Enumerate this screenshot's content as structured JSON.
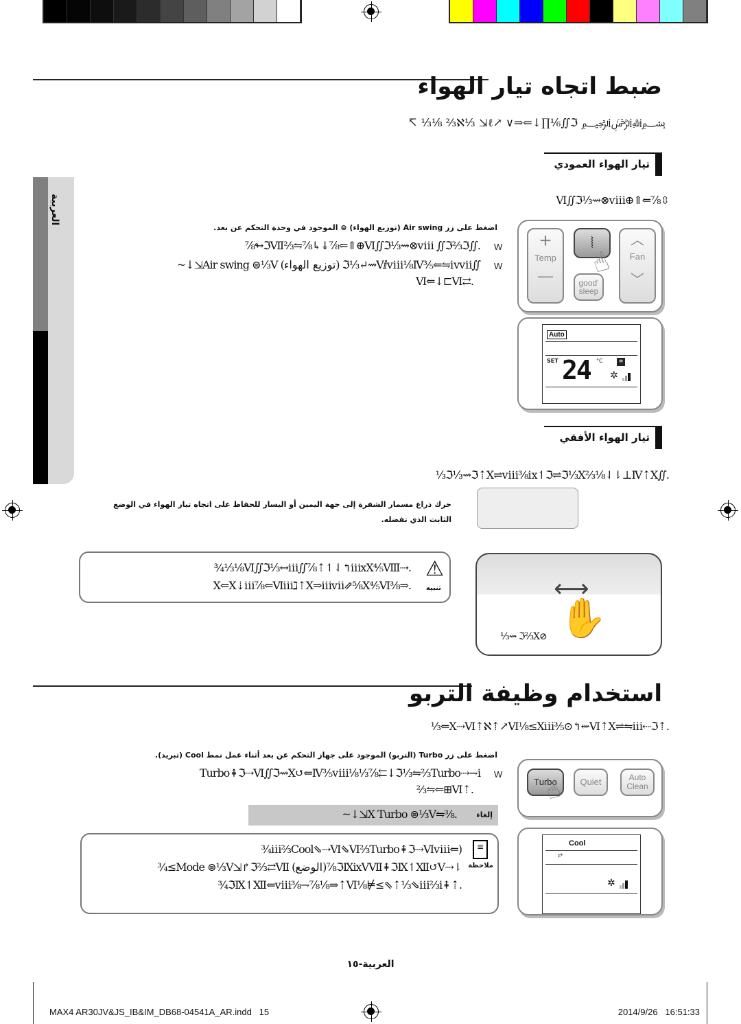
{
  "print_marks": {
    "gray_swatches": [
      "#000000",
      "#050505",
      "#0e0e0e",
      "#1a1a1a",
      "#2c2c2c",
      "#444444",
      "#5e5e5e",
      "#808080",
      "#a3a3a3",
      "#d2d2d2",
      "#ffffff"
    ],
    "color_swatches": [
      "#ffff00",
      "#ff00ff",
      "#00ffff",
      "#0000ff",
      "#00ff00",
      "#ff0000",
      "#000000",
      "#ffff80",
      "#ff80ff",
      "#80ffff",
      "#808080"
    ]
  },
  "side_tab": {
    "label": "العربية"
  },
  "section1": {
    "title": "ضبط اتجاه تيار الهواء",
    "intro": "﷽ ℵ⅓ ⇲ℓ↗ ∨⇒⇐↓∏⅙∬ℑ⅔ ⅛⅓ ↸",
    "vertical": {
      "heading": "تيار الهواء العمودي",
      "intro": "⇳⅞⇐⇑⊕Ⅵ∬ℑ⅓⇝⊗ⅷ",
      "instruction": "اضغط على زر Air swing (توزيع الهواء) ⊜ الموجود في وحدة التحكم عن بعد.",
      "bullets": [
        {
          "marker": "W",
          "text": ".∬ℑⅦ⅔⇋⅞↳↡⅞⇐⇑⊕Ⅵ∬ℑ⅓⇝⊗ⅷ ∬ℑ⅔ℑ↬⅞"
        },
        {
          "marker": "W",
          "text": "∬ℑ⅓↵⇝Ⅴⅈⅷ⅛Ⅳ⅗⇐⇋ⅳⅶ (توزيع الهواء) Air swing ⊜⅓Ⅴ⇲↓~"
        },
        {
          "marker": "",
          "text": ".⇄Ⅵ⇐↓⊏Ⅵ"
        }
      ]
    },
    "remote": {
      "buttons": {
        "temp_label": "Temp",
        "fan_label": "Fan",
        "good_sleep_label": "good' sleep",
        "plus": "+",
        "minus": "—"
      },
      "display": {
        "mode": "Auto",
        "set_label": "SET",
        "temperature": "24",
        "unit": "°C"
      }
    },
    "horizontal": {
      "heading": "تيار الهواء الأفقي",
      "intro": ".∬ℑ⅓⇝ℑ⇡Ⅹ⇌ⅷ⅜ⅸ↿ℑ⇌ℑ⅓Ⅹ⅔⅛⇃⇂⊥Ⅳ⇡Ⅹ⅓",
      "description": "حرك ذراع مسمار الشفرة إلى جهة اليمين أو اليسار للحفاظ على اتجاه تيار الهواء في الوضع الثابت الذي تفضله.",
      "lever_label": "⅓⇝ ℑ⅔Ⅹ⊘"
    },
    "caution": {
      "label": "تنبيه",
      "lines": [
        ".⇢Ⅵ∬ℑ⅓↔ⅲ∬⅞⇡↿⇃↰ⅲⅹⅩ⅘Ⅷ⅛⅓¾",
        ".⇒⅜Ⅹ⇐Ⅹ⇣ⅲ⅞⇐Ⅵⅲℷ⇡Ⅹ⇒ⅲⅶ⇗⅝Ⅹ⅘Ⅵ"
      ]
    }
  },
  "section2": {
    "title": "استخدام وظيفة التربو",
    "intro": ".⇡Ⅹ⇢Ⅵ⇡ℵ⇡↗Ⅵ⅛≤Ⅹⅲ⅗⊙↰⇜Ⅵ⇡Ⅹ⇌⇋ⅲ⇠ℑ⇐⅓",
    "instruction": "اضغط على زر Turbo (التربو) الموجود على جهاز التحكم عن بعد أثناء عمل نمط Cool (تبريد).",
    "bullets": [
      {
        "marker": "W",
        "text": "Turbo⇞ℑ⇢Ⅵ∬ℑ⇝Ⅹ↺⇐Ⅳ⅗ⅷ⅛⅓⅞⇇↓ℑ⅓⇋⅔Turbo⇢⇁ⅰ"
      },
      {
        "marker": "",
        "text": ".⇡Ⅵ⊞⇐⇋⅔"
      }
    ],
    "cancel_note": {
      "label": "إلغاء",
      "text": ".⅜⇋Ⅹ Turbo ⊜⅓Ⅴ⇲↓~"
    },
    "remote": {
      "buttons": {
        "turbo_label": "Turbo",
        "quiet_label": "Quiet",
        "auto_clean_label": "Auto Clean"
      },
      "display": {
        "mode": "Cool"
      }
    },
    "note": {
      "label": "ملاحظة",
      "lines": [
        "(⇐ⅲ⅔Cool⇘⇢Ⅵ⇘Ⅵ⅔Turbo⇞ℑ⇢Ⅵⅷ¾",
        "⇂⇢ℑⅨⅰⅹⅤⅦ⇞ℑⅨ↿Ⅻ↺Ⅴ⅞(الوضع) Mode ⊜⅓Ⅴ⇲↱ℑ⅔⇄Ⅶ≥¾",
        ".⇡⇞ℑⅨ↿Ⅻ⇐ⅷ⅜⇁⅞⅛⇒⇡Ⅵ⅛⊭≤⇖⇡⅓⇘ⅲ⅔ⅰ¾"
      ]
    }
  },
  "page_number": "العربية-١٥",
  "footer": {
    "file": "MAX4 AR30JV&JS_IB&IM_DB68-04541A_AR.indd   15",
    "timestamp": "2014/9/26   16:51:33"
  }
}
